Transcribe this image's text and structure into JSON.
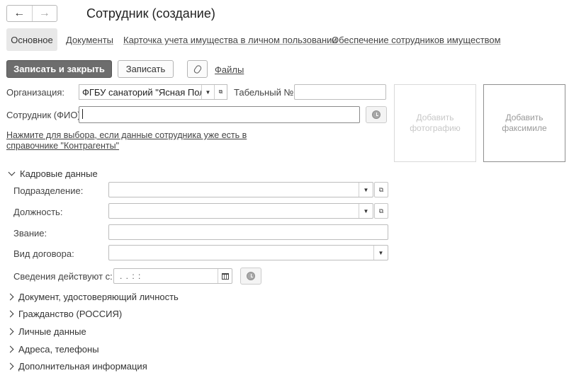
{
  "window": {
    "title": "Сотрудник (создание)"
  },
  "nav": {
    "back": "←",
    "forward": "→"
  },
  "tabs": [
    {
      "label": "Основное",
      "active": true
    },
    {
      "label": "Документы"
    },
    {
      "label": "Карточка учета имущества в личном пользовании"
    },
    {
      "label": "Обеспечение сотрудников имуществом"
    }
  ],
  "toolbar": {
    "save_close": "Записать и закрыть",
    "save": "Записать",
    "files": "Файлы"
  },
  "form": {
    "organization_label": "Организация:",
    "organization_value": "ФГБУ санаторий \"Ясная Поляна\"",
    "tabel_label": "Табельный №:",
    "tabel_value": "",
    "employee_label": "Сотрудник (ФИО):",
    "employee_value": "",
    "hint_link": "Нажмите для выбора, если данные сотрудника уже есть в справочнике \"Контрагенты\"",
    "add_photo": "Добавить фотографию",
    "add_fax": "Добавить факсимиле"
  },
  "hr_section": {
    "title": "Кадровые данные",
    "division_label": "Подразделение:",
    "position_label": "Должность:",
    "rank_label": "Звание:",
    "contract_label": "Вид договора:",
    "effective_label": "Сведения действуют с:",
    "effective_value": " .  .       :  :"
  },
  "collapsed_sections": [
    "Документ, удостоверяющий личность",
    "Гражданство (РОССИЯ)",
    "Личные данные",
    "Адреса, телефоны",
    "Дополнительная информация"
  ],
  "colors": {
    "primary_button": "#6d6d6d",
    "border": "#bdbdbd"
  }
}
